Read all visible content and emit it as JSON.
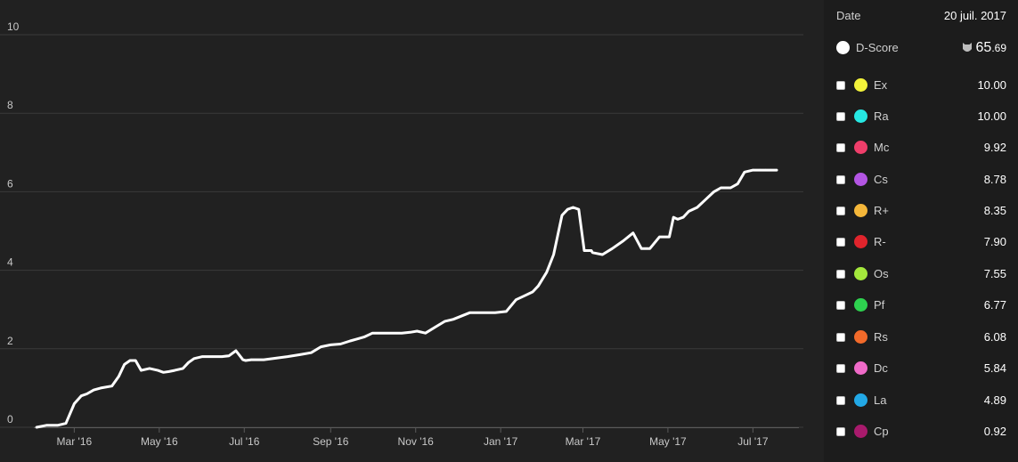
{
  "panel": {
    "date_label": "Date",
    "date_value": "20 juil. 2017",
    "score_label": "D-Score",
    "score_int": "65",
    "score_dec": ".69",
    "items": [
      {
        "label": "Ex",
        "value": "10.00",
        "color": "#f2f23a"
      },
      {
        "label": "Ra",
        "value": "10.00",
        "color": "#26e8e3"
      },
      {
        "label": "Mc",
        "value": "9.92",
        "color": "#ef3e6a"
      },
      {
        "label": "Cs",
        "value": "8.78",
        "color": "#b355e3"
      },
      {
        "label": "R+",
        "value": "8.35",
        "color": "#f5b73a"
      },
      {
        "label": "R-",
        "value": "7.90",
        "color": "#e0242c"
      },
      {
        "label": "Os",
        "value": "7.55",
        "color": "#a4e83c"
      },
      {
        "label": "Pf",
        "value": "6.77",
        "color": "#2ed24f"
      },
      {
        "label": "Rs",
        "value": "6.08",
        "color": "#f26a2a"
      },
      {
        "label": "Dc",
        "value": "5.84",
        "color": "#ef6ac8"
      },
      {
        "label": "La",
        "value": "4.89",
        "color": "#22a8e6"
      },
      {
        "label": "Cp",
        "value": "0.92",
        "color": "#a81a6c"
      }
    ]
  },
  "chart_data": {
    "type": "line",
    "title": "",
    "xlabel": "",
    "ylabel": "",
    "ylim": [
      0,
      10
    ],
    "yticks": [
      "0",
      "2",
      "4",
      "6",
      "8",
      "10"
    ],
    "xtick_labels": [
      "Mar '16",
      "May '16",
      "Jul '16",
      "Sep '16",
      "Nov '16",
      "Jan '17",
      "Mar '17",
      "May '17",
      "Jul '17"
    ],
    "grid": true,
    "series": [
      {
        "color": "#ffffff",
        "x": [
          "2016-02-03",
          "2016-02-10",
          "2016-02-18",
          "2016-02-24",
          "2016-03-01",
          "2016-03-06",
          "2016-03-10",
          "2016-03-15",
          "2016-03-20",
          "2016-03-28",
          "2016-04-02",
          "2016-04-06",
          "2016-04-10",
          "2016-04-14",
          "2016-04-18",
          "2016-04-24",
          "2016-04-30",
          "2016-05-04",
          "2016-05-08",
          "2016-05-12",
          "2016-05-18",
          "2016-05-22",
          "2016-05-26",
          "2016-06-01",
          "2016-06-08",
          "2016-06-15",
          "2016-06-20",
          "2016-06-25",
          "2016-06-30",
          "2016-07-02",
          "2016-07-06",
          "2016-07-15",
          "2016-08-01",
          "2016-08-10",
          "2016-08-18",
          "2016-08-25",
          "2016-09-01",
          "2016-09-08",
          "2016-09-15",
          "2016-09-20",
          "2016-09-25",
          "2016-10-01",
          "2016-10-08",
          "2016-10-15",
          "2016-10-22",
          "2016-10-28",
          "2016-11-02",
          "2016-11-08",
          "2016-11-15",
          "2016-11-22",
          "2016-11-28",
          "2016-12-05",
          "2016-12-10",
          "2016-12-15",
          "2016-12-20",
          "2016-12-28",
          "2017-01-05",
          "2017-01-12",
          "2017-01-18",
          "2017-01-24",
          "2017-01-28",
          "2017-02-03",
          "2017-02-08",
          "2017-02-14",
          "2017-02-18",
          "2017-02-22",
          "2017-02-26",
          "2017-03-02",
          "2017-03-07",
          "2017-03-08",
          "2017-03-15",
          "2017-03-22",
          "2017-03-30",
          "2017-04-06",
          "2017-04-12",
          "2017-04-14",
          "2017-04-18",
          "2017-04-25",
          "2017-05-02",
          "2017-05-05",
          "2017-05-08",
          "2017-05-12",
          "2017-05-16",
          "2017-05-22",
          "2017-05-28",
          "2017-06-03",
          "2017-06-08",
          "2017-06-15",
          "2017-06-20",
          "2017-06-25",
          "2017-07-01",
          "2017-07-06",
          "2017-07-10",
          "2017-07-14",
          "2017-07-18"
        ],
        "y": [
          0.0,
          0.05,
          0.05,
          0.1,
          0.6,
          0.8,
          0.85,
          0.95,
          1.0,
          1.05,
          1.3,
          1.6,
          1.7,
          1.7,
          1.45,
          1.5,
          1.45,
          1.4,
          1.42,
          1.45,
          1.5,
          1.65,
          1.75,
          1.8,
          1.8,
          1.8,
          1.82,
          1.95,
          1.72,
          1.7,
          1.72,
          1.72,
          1.8,
          1.85,
          1.9,
          2.05,
          2.1,
          2.12,
          2.2,
          2.25,
          2.3,
          2.4,
          2.4,
          2.4,
          2.4,
          2.42,
          2.45,
          2.4,
          2.55,
          2.7,
          2.75,
          2.85,
          2.92,
          2.92,
          2.92,
          2.92,
          2.95,
          3.25,
          3.35,
          3.45,
          3.6,
          3.95,
          4.4,
          5.4,
          5.55,
          5.6,
          5.55,
          4.5,
          4.5,
          4.45,
          4.4,
          4.55,
          4.75,
          4.95,
          4.55,
          4.55,
          4.55,
          4.85,
          4.85,
          5.35,
          5.3,
          5.35,
          5.5,
          5.6,
          5.8,
          6.0,
          6.1,
          6.1,
          6.2,
          6.5,
          6.55,
          6.55,
          6.55,
          6.55,
          6.55
        ]
      }
    ]
  }
}
